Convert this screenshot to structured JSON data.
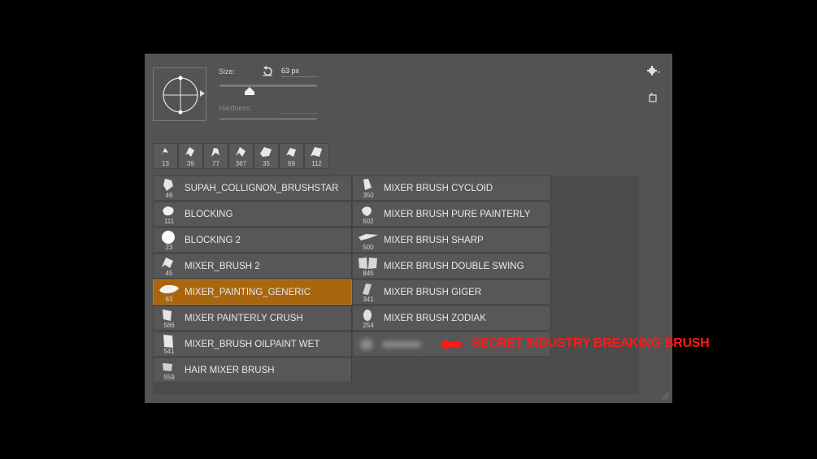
{
  "panel": {
    "size_label": "Size:",
    "size_value": "63 px",
    "hardness_label": "Hardness:"
  },
  "recent_brushes": [
    "13",
    "39",
    "77",
    "367",
    "35",
    "69",
    "112"
  ],
  "brushes_left": [
    {
      "size": "46",
      "name": "SUPAH_COLLIGNON_BRUSHSTAR"
    },
    {
      "size": "111",
      "name": "BLOCKING"
    },
    {
      "size": "23",
      "name": "BLOCKING 2"
    },
    {
      "size": "45",
      "name": "MIXER_BRUSH 2"
    },
    {
      "size": "63",
      "name": "MIXER_PAINTING_GENERIC",
      "selected": true
    },
    {
      "size": "586",
      "name": "MIXER PAINTERLY CRUSH"
    },
    {
      "size": "541",
      "name": "MIXER_BRUSH OILPAINT WET"
    },
    {
      "size": "559",
      "name": "HAIR MIXER BRUSH"
    }
  ],
  "brushes_right": [
    {
      "size": "350",
      "name": "MIXER BRUSH CYCLOID"
    },
    {
      "size": "502",
      "name": "MIXER BRUSH PURE PAINTERLY"
    },
    {
      "size": "500",
      "name": "MIXER BRUSH SHARP"
    },
    {
      "size": "845",
      "name": "MIXER BRUSH DOUBLE SWING"
    },
    {
      "size": "341",
      "name": "MIXER BRUSH GIGER"
    },
    {
      "size": "254",
      "name": "MIXER BRUSH ZODIAK"
    }
  ],
  "annotation": {
    "text": "SECRET INDUSTRY BREAKING BRUSH",
    "color": "#ff1a1a"
  },
  "colors": {
    "panel_bg": "#535353",
    "selected_bg": "#a9660e"
  }
}
